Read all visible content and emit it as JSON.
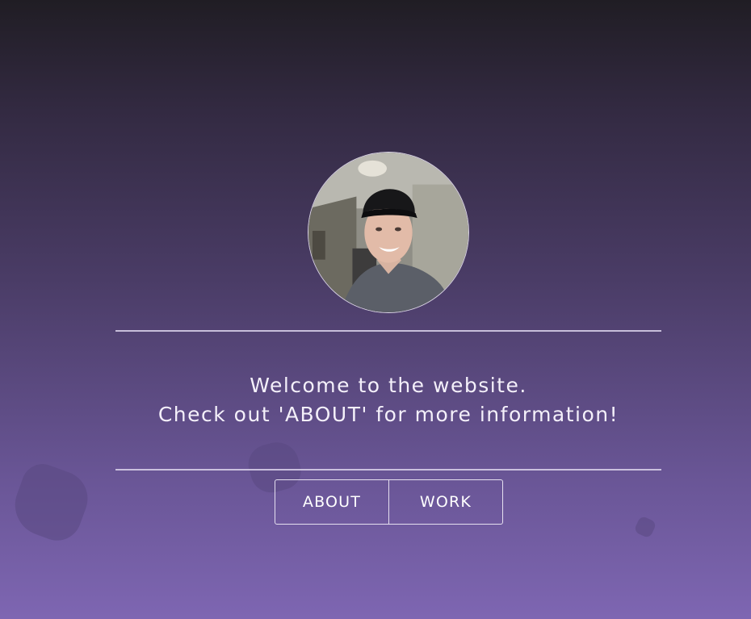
{
  "hero": {
    "welcome_line1": "Welcome to the website.",
    "welcome_line2": "Check out 'ABOUT' for more information!"
  },
  "nav": {
    "buttons": [
      {
        "label": "ABOUT"
      },
      {
        "label": "WORK"
      }
    ]
  },
  "colors": {
    "background_top": "#201d24",
    "background_bottom": "#7e66b2",
    "text": "#ffffff"
  }
}
